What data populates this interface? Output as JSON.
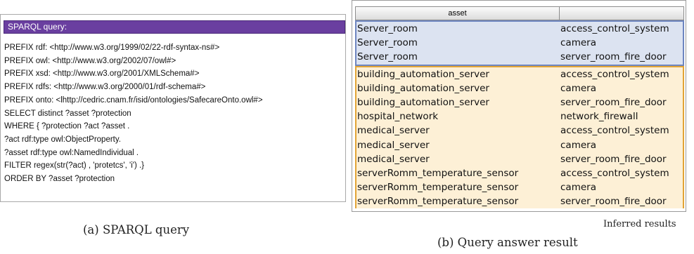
{
  "query_panel": {
    "header": "SPARQL query:",
    "lines": [
      "PREFIX rdf: <http://www.w3.org/1999/02/22-rdf-syntax-ns#>",
      "PREFIX owl: <http://www.w3.org/2002/07/owl#>",
      "PREFIX xsd: <http://www.w3.org/2001/XMLSchema#>",
      "PREFIX rdfs: <http://www.w3.org/2000/01/rdf-schema#>",
      "PREFIX onto: <lhttp://cedric.cnam.fr/isid/ontologies/SafecareOnto.owl#>",
      "SELECT distinct ?asset  ?protection",
      "WHERE { ?protection ?act ?asset .",
      "?act rdf:type owl:ObjectProperty.",
      "?asset rdf:type owl:NamedIndividual .",
      "FILTER regex(str(?act) , 'protetcs', 'i') .}",
      "ORDER BY  ?asset ?protection"
    ]
  },
  "results_panel": {
    "columns": [
      "asset",
      ""
    ],
    "group_blue_rows": [
      [
        "Server_room",
        "access_control_system"
      ],
      [
        "Server_room",
        "camera"
      ],
      [
        "Server_room",
        "server_room_fire_door"
      ]
    ],
    "group_orange_rows": [
      [
        "building_automation_server",
        "access_control_system"
      ],
      [
        "building_automation_server",
        "camera"
      ],
      [
        "building_automation_server",
        "server_room_fire_door"
      ],
      [
        "hospital_network",
        "network_firewall"
      ],
      [
        "medical_server",
        "access_control_system"
      ],
      [
        "medical_server",
        "camera"
      ],
      [
        "medical_server",
        "server_room_fire_door"
      ],
      [
        "serverRomm_temperature_sensor",
        "access_control_system"
      ],
      [
        "serverRomm_temperature_sensor",
        "camera"
      ],
      [
        "serverRomm_temperature_sensor",
        "server_room_fire_door"
      ]
    ],
    "group_colors": {
      "blue": "#6e86c0",
      "orange": "#e2a436"
    }
  },
  "captions": {
    "inferred": "Inferred results",
    "a": "(a) SPARQL query",
    "b": "(b) Query answer result"
  }
}
